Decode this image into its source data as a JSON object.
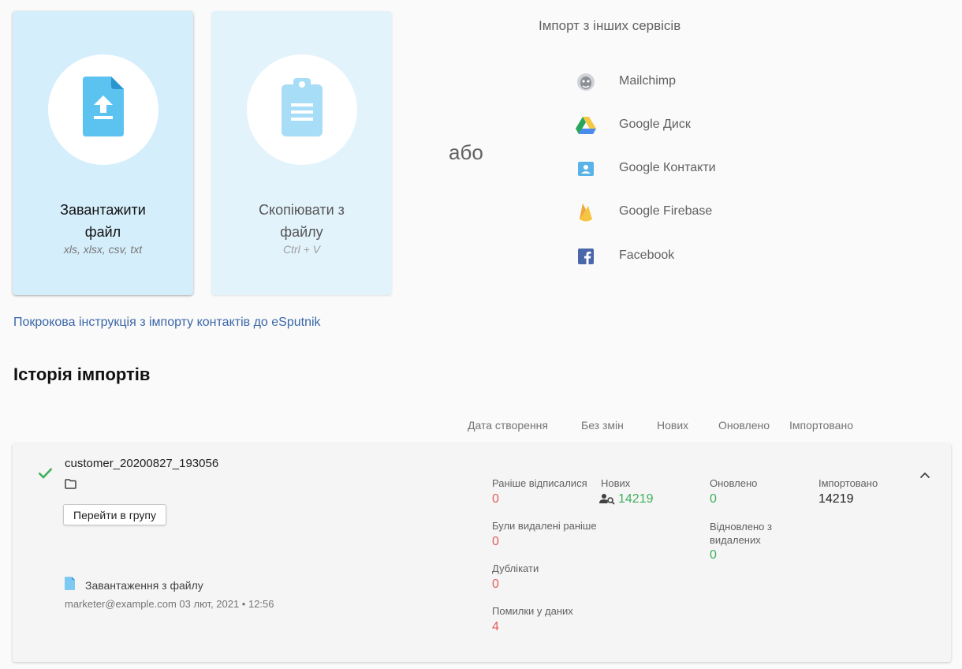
{
  "upload_card": {
    "title": "Завантажити файл",
    "subtitle": "xls, xlsx, csv, txt"
  },
  "paste_card": {
    "title": "Скопіювати з файлу",
    "subtitle": "Ctrl + V"
  },
  "or_text": "або",
  "services": {
    "title": "Імпорт з інших сервісів",
    "items": [
      {
        "label": "Mailchimp",
        "icon": "mailchimp-icon"
      },
      {
        "label": "Google Диск",
        "icon": "google-drive-icon"
      },
      {
        "label": "Google Контакти",
        "icon": "google-contacts-icon"
      },
      {
        "label": "Google Firebase",
        "icon": "firebase-icon"
      },
      {
        "label": "Facebook",
        "icon": "facebook-icon"
      }
    ]
  },
  "guide_link": "Покрокова інструкція з імпорту контактів до eSputnik",
  "history": {
    "title": "Історія імпортів",
    "columns": [
      "Дата створення",
      "Без змін",
      "Нових",
      "Оновлено",
      "Імпортовано"
    ],
    "row": {
      "file_name": "customer_20200827_193056",
      "go_button": "Перейти в групу",
      "source": "Завантаження з файлу",
      "meta": "marketer@example.com  03 лют, 2021 • 12:56",
      "stats": {
        "unsubscribed": {
          "label": "Раніше відписалися",
          "value": "0"
        },
        "deleted": {
          "label": "Були видалені раніше",
          "value": "0"
        },
        "duplicates": {
          "label": "Дублікати",
          "value": "0"
        },
        "errors": {
          "label": "Помилки у даних",
          "value": "4"
        },
        "new": {
          "label": "Нових",
          "value": "14219"
        },
        "updated": {
          "label": "Оновлено",
          "value": "0"
        },
        "restored": {
          "label": "Відновлено з видалених",
          "value": "0"
        },
        "imported": {
          "label": "Імпортовано",
          "value": "14219"
        }
      }
    }
  },
  "colors": {
    "link": "#3a66a8",
    "red": "#e35d5d",
    "green": "#3fb05c",
    "card_upload": "#d5eefb",
    "card_paste": "#e3f3fc"
  }
}
